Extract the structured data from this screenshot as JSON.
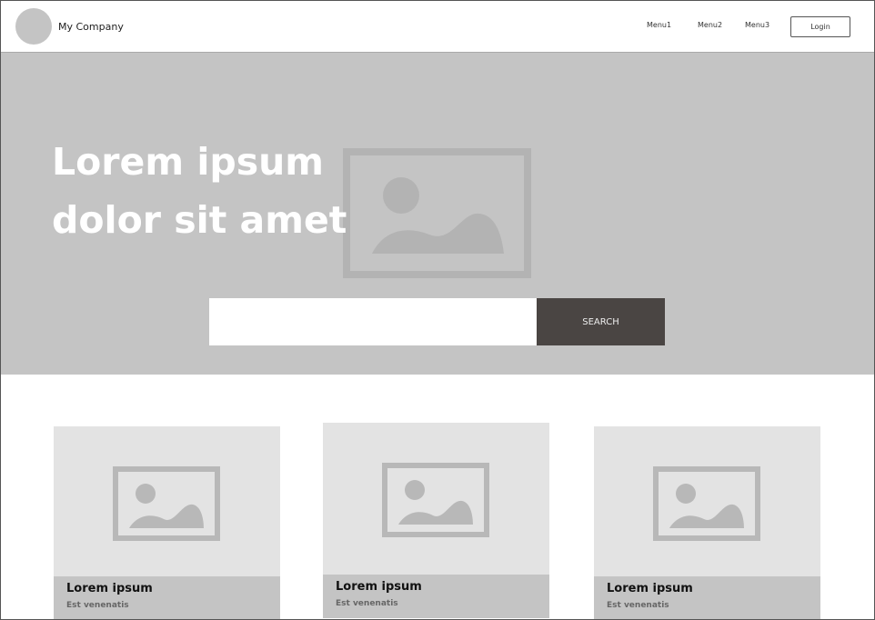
{
  "header": {
    "company": "My Company",
    "menu": [
      "Menu1",
      "Menu2",
      "Menu3"
    ],
    "login": "Login"
  },
  "hero": {
    "title_line1": "Lorem ipsum",
    "title_line2": "dolor sit amet",
    "search_placeholder": "",
    "search_button": "SEARCH"
  },
  "cards": [
    {
      "title": "Lorem ipsum",
      "subtitle": "Est venenatis"
    },
    {
      "title": "Lorem ipsum",
      "subtitle": "Est venenatis"
    },
    {
      "title": "Lorem ipsum",
      "subtitle": "Est venenatis"
    }
  ],
  "colors": {
    "hero_bg": "#c4c4c4",
    "button_bg": "#4a4543",
    "card_bg": "#e3e3e3"
  }
}
